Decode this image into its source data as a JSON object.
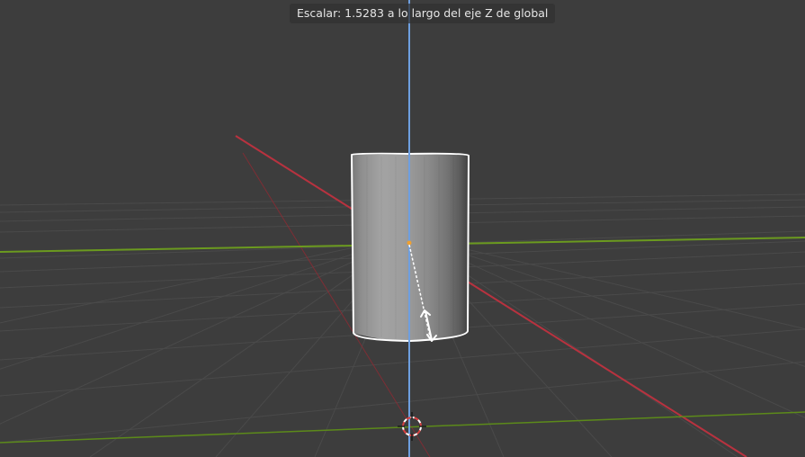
{
  "app": "Blender",
  "header": {
    "operation_status": "Escalar: 1.5283 a lo largo del eje Z de global"
  },
  "transform": {
    "operation": "Escalar",
    "value": 1.5283,
    "axis": "Z",
    "orientation": "global"
  },
  "viewport": {
    "background_color": "#3d3d3d",
    "grid_color": "#4a4a4a",
    "x_axis_color": "#b8323f",
    "y_axis_color": "#6b9a1f",
    "z_axis_color": "#6e9fe0",
    "selection_outline_color": "#ffffff",
    "object": "cylinder",
    "object_selected": true
  }
}
